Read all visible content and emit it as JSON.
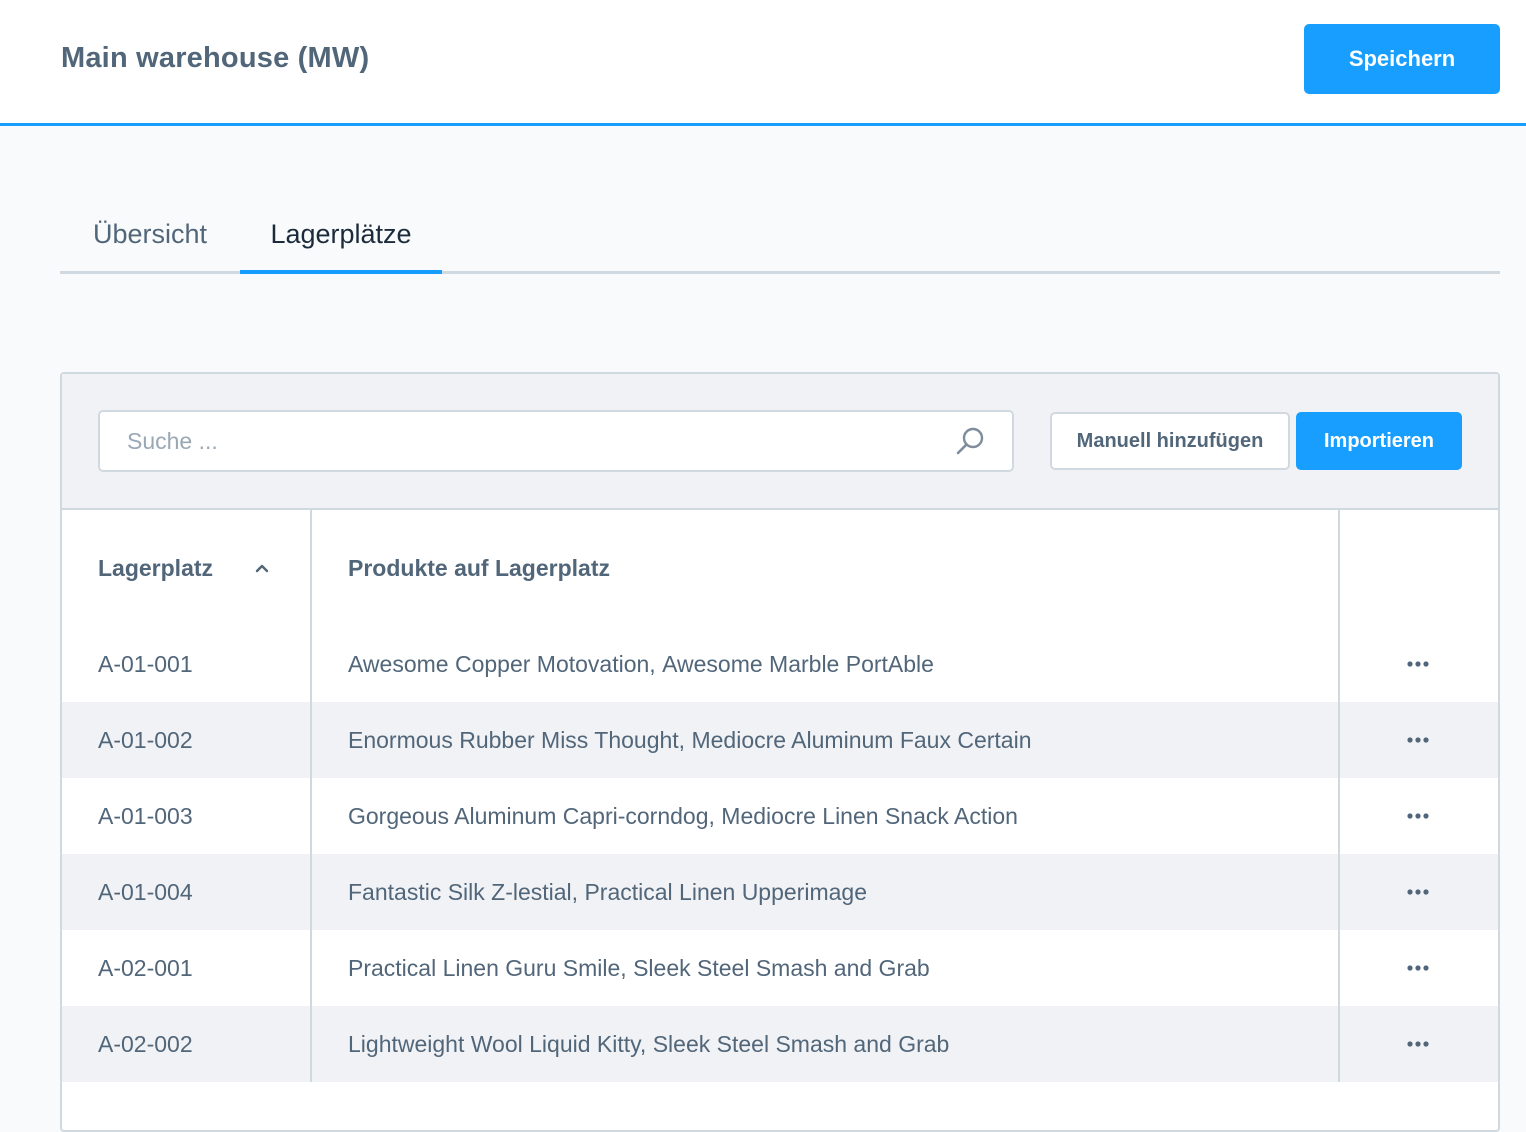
{
  "header": {
    "title": "Main warehouse (MW)",
    "save_label": "Speichern"
  },
  "tabs": [
    {
      "label": "Übersicht",
      "active": false
    },
    {
      "label": "Lagerplätze",
      "active": true
    }
  ],
  "toolbar": {
    "search_placeholder": "Suche ...",
    "search_value": "",
    "manual_add_label": "Manuell hinzufügen",
    "import_label": "Importieren"
  },
  "table": {
    "columns": [
      "Lagerplatz",
      "Produkte auf Lagerplatz"
    ],
    "sort": {
      "column": "Lagerplatz",
      "direction": "ascending",
      "icon": "chevron-up-icon"
    },
    "rows": [
      {
        "location": "A-01-001",
        "products": [
          "Awesome Copper Motovation,",
          "Awesome Marble PortAble"
        ]
      },
      {
        "location": "A-01-002",
        "products": [
          "Enormous Rubber Miss Thought,",
          "Mediocre Aluminum Faux Certain"
        ]
      },
      {
        "location": "A-01-003",
        "products": [
          "Gorgeous Aluminum Capri-corndog,",
          "Mediocre Linen Snack Action"
        ]
      },
      {
        "location": "A-01-004",
        "products": [
          "Fantastic Silk Z-lestial,",
          "Practical Linen Upperimage"
        ]
      },
      {
        "location": "A-02-001",
        "products": [
          "Practical Linen Guru Smile,",
          "Sleek Steel Smash and Grab"
        ]
      },
      {
        "location": "A-02-002",
        "products": [
          "Lightweight Wool Liquid Kitty,",
          "Sleek Steel Smash and Grab"
        ]
      }
    ]
  },
  "colors": {
    "accent": "#189eff",
    "text": "#52667a",
    "border": "#d1d9e0",
    "row_alt": "#f0f2f5"
  },
  "icons": {
    "search": "search-icon",
    "row_actions": "more-horizontal-icon"
  }
}
